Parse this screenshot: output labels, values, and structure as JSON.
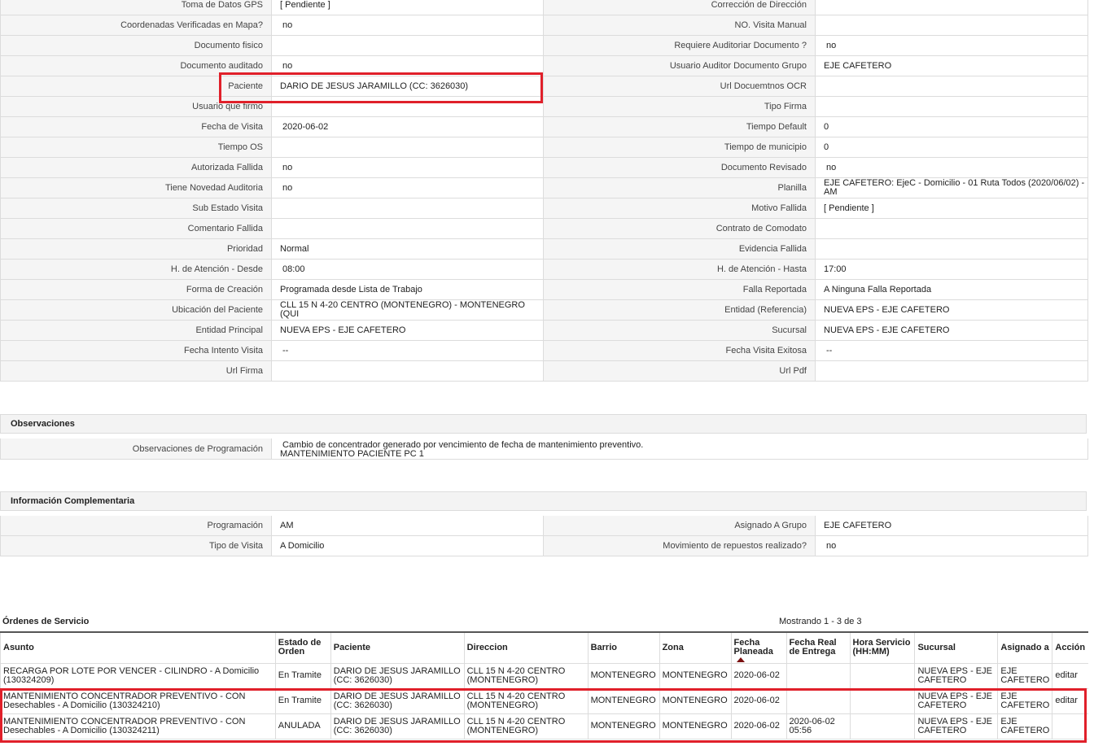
{
  "details": [
    {
      "l": "Toma de Datos GPS",
      "v": "[ Pendiente ]",
      "l2": "Corrección de Dirección",
      "v2": ""
    },
    {
      "l": "Coordenadas Verificadas en Mapa?",
      "v": "no",
      "l2": "NO. Visita Manual",
      "v2": ""
    },
    {
      "l": "Documento fisico",
      "v": "",
      "l2": "Requiere Auditoriar Documento ?",
      "v2": "no"
    },
    {
      "l": "Documento auditado",
      "v": "no",
      "l2": "Usuario Auditor Documento Grupo",
      "v2": "EJE CAFETERO"
    },
    {
      "l": "Paciente",
      "v": "DARIO DE JESUS JARAMILLO (CC: 3626030)",
      "l2": "Url Docuemtnos OCR",
      "v2": ""
    },
    {
      "l": "Usuario que firmo",
      "v": "",
      "l2": "Tipo Firma",
      "v2": ""
    },
    {
      "l": "Fecha de Visita",
      "v": "2020-06-02",
      "l2": "Tiempo Default",
      "v2": "0"
    },
    {
      "l": "Tiempo OS",
      "v": "",
      "l2": "Tiempo de municipio",
      "v2": "0"
    },
    {
      "l": "Autorizada Fallida",
      "v": "no",
      "l2": "Documento Revisado",
      "v2": "no"
    },
    {
      "l": "Tiene Novedad Auditoria",
      "v": "no",
      "l2": "Planilla",
      "v2": "EJE CAFETERO: EjeC - Domicilio - 01 Ruta Todos (2020/06/02) - AM"
    },
    {
      "l": "Sub Estado Visita",
      "v": "",
      "l2": "Motivo Fallida",
      "v2": "[ Pendiente ]"
    },
    {
      "l": "Comentario Fallida",
      "v": "",
      "l2": "Contrato de Comodato",
      "v2": ""
    },
    {
      "l": "Prioridad",
      "v": "Normal",
      "l2": "Evidencia Fallida",
      "v2": ""
    },
    {
      "l": "H. de Atención - Desde",
      "v": "08:00",
      "l2": "H. de Atención - Hasta",
      "v2": "17:00"
    },
    {
      "l": "Forma de Creación",
      "v": "Programada desde Lista de Trabajo",
      "l2": "Falla Reportada",
      "v2": "A Ninguna Falla Reportada"
    },
    {
      "l": "Ubicación del Paciente",
      "v": "CLL 15 N 4-20 CENTRO (MONTENEGRO) - MONTENEGRO (QUI",
      "l2": "Entidad (Referencia)",
      "v2": "NUEVA EPS - EJE CAFETERO"
    },
    {
      "l": "Entidad Principal",
      "v": "NUEVA EPS - EJE CAFETERO",
      "l2": "Sucursal",
      "v2": "NUEVA EPS - EJE CAFETERO"
    },
    {
      "l": "Fecha Intento Visita",
      "v": "--",
      "l2": "Fecha Visita Exitosa",
      "v2": "--"
    },
    {
      "l": "Url Firma",
      "v": "",
      "l2": "Url Pdf",
      "v2": ""
    }
  ],
  "observaciones": {
    "title": "Observaciones",
    "label": "Observaciones de Programación",
    "line1": "Cambio de concentrador generado por vencimiento de fecha de mantenimiento preventivo.",
    "line2": "MANTENIMIENTO PACIENTE PC 1"
  },
  "info": {
    "title": "Información Complementaria",
    "rows": [
      {
        "l": "Programación",
        "v": "AM",
        "l2": "Asignado A Grupo",
        "v2": "EJE CAFETERO"
      },
      {
        "l": "Tipo de Visita",
        "v": "A Domicilio",
        "l2": "Movimiento de repuestos realizado?",
        "v2": "no"
      }
    ]
  },
  "ordenes": {
    "title": "Órdenes de Servicio",
    "count": "Mostrando 1 - 3 de 3",
    "headers": [
      "Asunto",
      "Estado de Orden",
      "Paciente",
      "Direccion",
      "Barrio",
      "Zona",
      "Fecha Planeada",
      "Fecha Real de Entrega",
      "Hora Servicio (HH:MM)",
      "Sucursal",
      "Asignado a",
      "Acción"
    ],
    "rows": [
      [
        "RECARGA POR LOTE POR VENCER - CILINDRO - A Domicilio (130324209)",
        "En Tramite",
        "DARIO DE JESUS JARAMILLO (CC: 3626030)",
        "CLL 15 N 4-20 CENTRO (MONTENEGRO)",
        "MONTENEGRO",
        "MONTENEGRO",
        "2020-06-02",
        "",
        "",
        "NUEVA EPS - EJE CAFETERO",
        "EJE CAFETERO",
        "editar"
      ],
      [
        "MANTENIMIENTO CONCENTRADOR PREVENTIVO - CON Desechables - A Domicilio (130324210)",
        "En Tramite",
        "DARIO DE JESUS JARAMILLO (CC: 3626030)",
        "CLL 15 N 4-20 CENTRO (MONTENEGRO)",
        "MONTENEGRO",
        "MONTENEGRO",
        "2020-06-02",
        "",
        "",
        "NUEVA EPS - EJE CAFETERO",
        "EJE CAFETERO",
        "editar"
      ],
      [
        "MANTENIMIENTO CONCENTRADOR PREVENTIVO - CON Desechables - A Domicilio (130324211)",
        "ANULADA",
        "DARIO DE JESUS JARAMILLO (CC: 3626030)",
        "CLL 15 N 4-20 CENTRO (MONTENEGRO)",
        "MONTENEGRO",
        "MONTENEGRO",
        "2020-06-02",
        "2020-06-02 05:56",
        "",
        "NUEVA EPS - EJE CAFETERO",
        "EJE CAFETERO",
        ""
      ]
    ]
  },
  "colors": {
    "highlight": "#e0202a",
    "label_bg": "#f5f5f5",
    "border": "#dcdcdc"
  }
}
